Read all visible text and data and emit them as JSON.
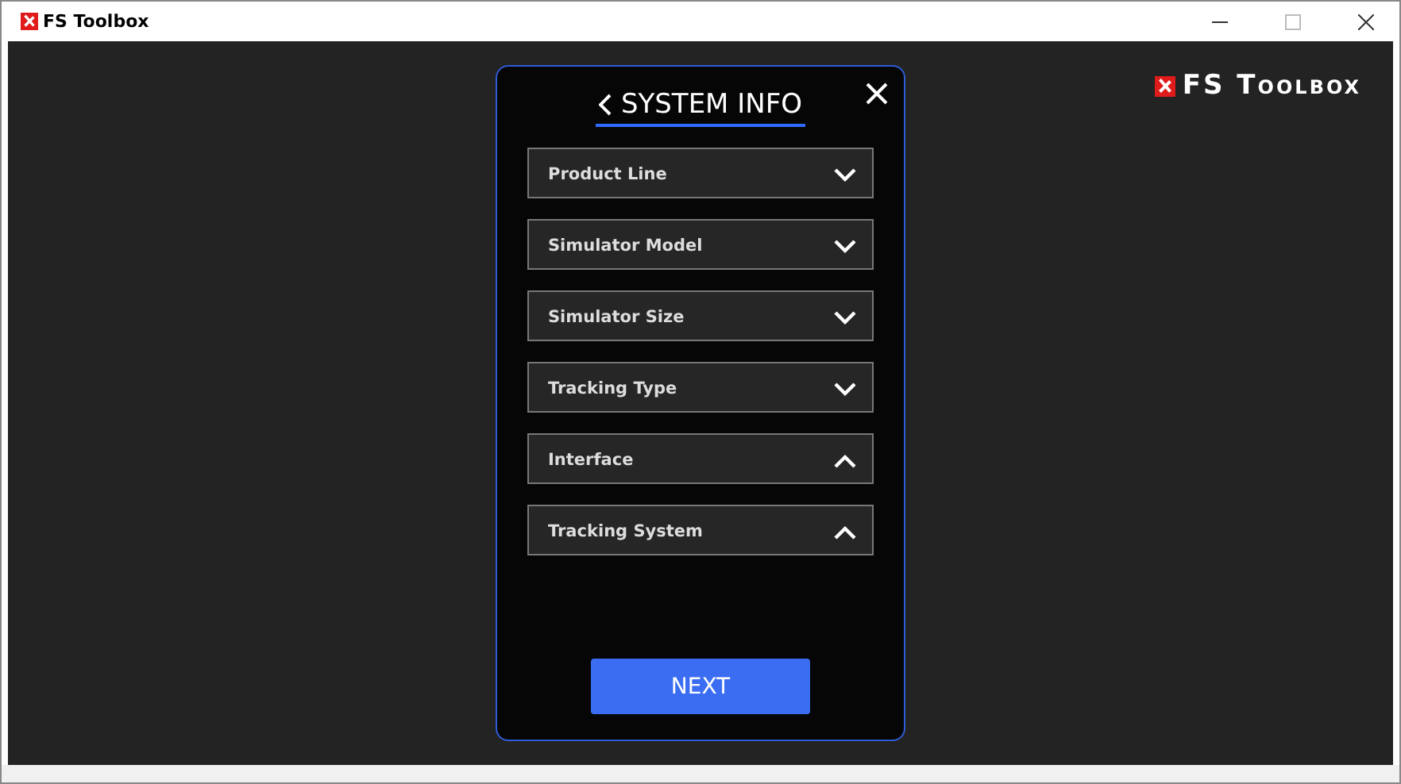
{
  "window": {
    "title": "FS Toolbox"
  },
  "logo": {
    "text": "FS Toolbox"
  },
  "dialog": {
    "title": "SYSTEM INFO",
    "dropdowns": [
      {
        "label": "Product Line",
        "expanded": false
      },
      {
        "label": "Simulator Model",
        "expanded": false
      },
      {
        "label": "Simulator Size",
        "expanded": false
      },
      {
        "label": "Tracking Type",
        "expanded": false
      },
      {
        "label": "Interface",
        "expanded": true
      },
      {
        "label": "Tracking System",
        "expanded": true
      }
    ],
    "next_button": "NEXT"
  }
}
